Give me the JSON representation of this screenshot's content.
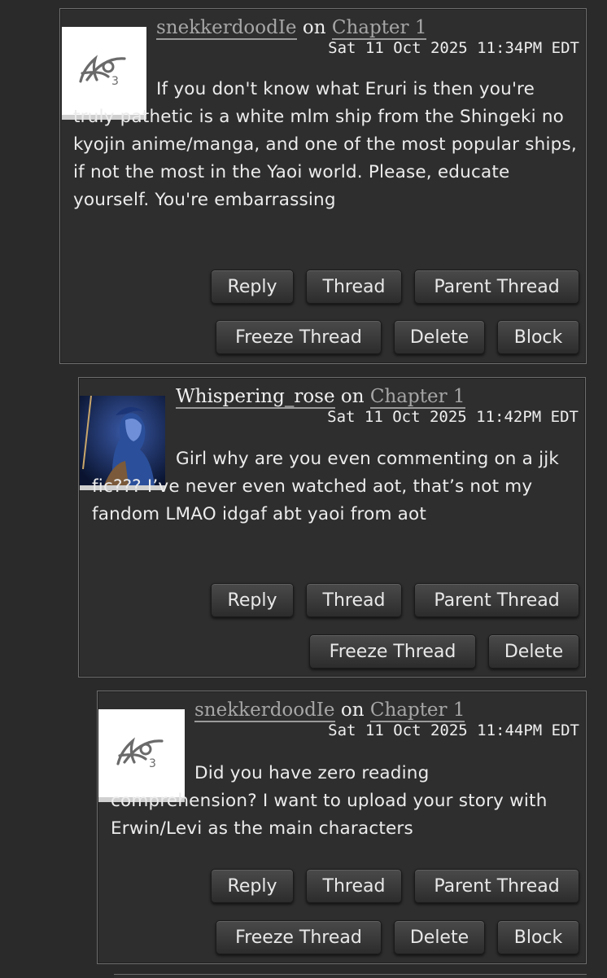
{
  "comments": [
    {
      "author": "snekkerdoodIe",
      "on": "on",
      "chapter": "Chapter 1",
      "datetime": "Sat 11 Oct 2025 11:34PM EDT",
      "avatar_icon": "ao3-logo-icon",
      "body": "If you don't know what Eruri is then you're truly pathetic is a white mlm ship from the Shingeki no kyojin anime/manga, and one of the most popular ships, if not the most in the Yaoi world. Please, educate yourself. You're embarrassing",
      "buttons": {
        "reply": "Reply",
        "thread": "Thread",
        "parent_thread": "Parent Thread",
        "freeze_thread": "Freeze Thread",
        "delete": "Delete",
        "block": "Block"
      }
    },
    {
      "author": "Whispering_rose",
      "on": "on",
      "chapter": "Chapter 1",
      "datetime": "Sat 11 Oct 2025 11:42PM EDT",
      "avatar_icon": "user-photo-avatar",
      "body": "Girl why are you even commenting on a jjk fic??? I’ve never even watched aot, that’s not my fandom LMAO idgaf abt yaoi from aot",
      "buttons": {
        "reply": "Reply",
        "thread": "Thread",
        "parent_thread": "Parent Thread",
        "freeze_thread": "Freeze Thread",
        "delete": "Delete"
      }
    },
    {
      "author": "snekkerdoodIe",
      "on": "on",
      "chapter": "Chapter 1",
      "datetime": "Sat 11 Oct 2025 11:44PM EDT",
      "avatar_icon": "ao3-logo-icon",
      "body": "Did you have zero reading comprehension? I want to upload your story with Erwin/Levi as the main characters",
      "buttons": {
        "reply": "Reply",
        "thread": "Thread",
        "parent_thread": "Parent Thread",
        "freeze_thread": "Freeze Thread",
        "delete": "Delete",
        "block": "Block"
      }
    }
  ],
  "colors": {
    "background": "#2a2a2a",
    "panel": "#2e2e2e",
    "link": "#a6a6a6",
    "text": "#ececec"
  }
}
